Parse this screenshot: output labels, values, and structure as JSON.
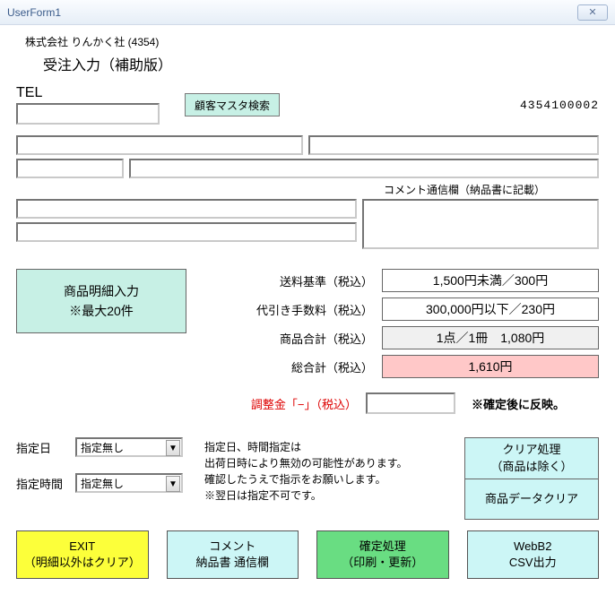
{
  "window": {
    "title": "UserForm1"
  },
  "header": {
    "company": "株式会社 りんかく社 (4354)",
    "screen_title": "受注入力（補助版）",
    "id_code": "4354100002"
  },
  "tel": {
    "label": "TEL",
    "value": "",
    "search_btn": "顧客マスタ検索"
  },
  "comment_header": "コメント通信欄（納品書に記載）",
  "totals": {
    "shipping_label": "送料基準（税込）",
    "shipping_value": "1,500円未満／300円",
    "cod_label": "代引き手数料（税込）",
    "cod_value": "300,000円以下／230円",
    "subtotal_label": "商品合計（税込）",
    "subtotal_value": "1点／1冊　1,080円",
    "grand_label": "総合計（税込）",
    "grand_value": "1,610円"
  },
  "detail_btn": {
    "line1": "商品明細入力",
    "line2": "※最大20件"
  },
  "adjust": {
    "label": "調整金「−」（税込）",
    "note": "※確定後に反映。"
  },
  "spec": {
    "date_label": "指定日",
    "date_value": "指定無し",
    "time_label": "指定時間",
    "time_value": "指定無し",
    "note1": "指定日、時間指定は",
    "note2": "出荷日時により無効の可能性があります。",
    "note3": "確認したうえで指示をお願いします。",
    "note4": "※翌日は指定不可です。"
  },
  "side": {
    "clear1a": "クリア処理",
    "clear1b": "（商品は除く）",
    "clear2": "商品データクリア"
  },
  "bottom": {
    "exit1": "EXIT",
    "exit2": "（明細以外はクリア）",
    "comm1": "コメント",
    "comm2": "納品書 通信欄",
    "confirm1": "確定処理",
    "confirm2": "（印刷・更新）",
    "web1": "WebB2",
    "web2": "CSV出力"
  }
}
